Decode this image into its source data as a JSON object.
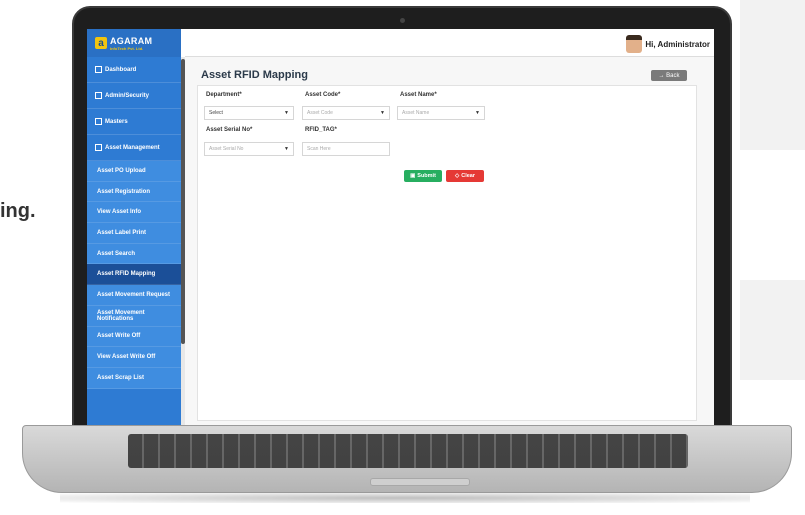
{
  "background": {
    "fragment_1": "ing."
  },
  "app": {
    "logo_title": "AGARAM",
    "logo_subtitle": "InfoTech Pvt. Ltd.",
    "greeting": "Hi, Administrator",
    "brand_color": "#2e7bd3"
  },
  "sidebar": {
    "main_items": [
      {
        "label": "Dashboard",
        "icon": "chart-icon"
      },
      {
        "label": "Admin/Security",
        "icon": "users-icon"
      },
      {
        "label": "Masters",
        "icon": "monitor-icon"
      },
      {
        "label": "Asset Management",
        "icon": "list-icon"
      }
    ],
    "sub_items": [
      {
        "label": "Asset PO Upload"
      },
      {
        "label": "Asset Registration"
      },
      {
        "label": "View Asset Info"
      },
      {
        "label": "Asset Label Print"
      },
      {
        "label": "Asset Search"
      },
      {
        "label": "Asset RFID Mapping",
        "active": true
      },
      {
        "label": "Asset Movement Request"
      },
      {
        "label": "Asset Movement Notifications"
      },
      {
        "label": "Asset Write Off"
      },
      {
        "label": "View Asset Write Off"
      },
      {
        "label": "Asset Scrap List"
      }
    ]
  },
  "page": {
    "title": "Asset RFID Mapping",
    "back_label": "→ Back"
  },
  "form": {
    "department": {
      "label": "Department*",
      "value": "Select"
    },
    "asset_code": {
      "label": "Asset Code*",
      "placeholder": "Asset Code"
    },
    "asset_name": {
      "label": "Asset Name*",
      "placeholder": "Asset Name"
    },
    "asset_serial": {
      "label": "Asset Serial No*",
      "placeholder": "Asset Serial No"
    },
    "rfid_tag": {
      "label": "RFID_TAG*",
      "placeholder": "Scan Here"
    },
    "submit_label": "Submit",
    "clear_label": "Clear"
  }
}
